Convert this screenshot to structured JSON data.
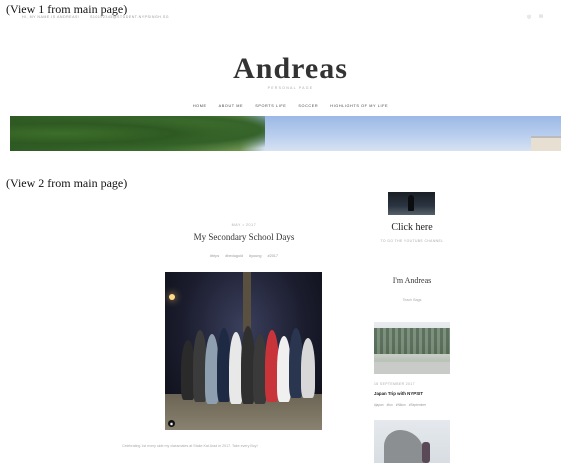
{
  "labels": {
    "view1": "(View 1 from main page)",
    "view2": "(View 2 from main page)"
  },
  "topbar": {
    "name": "HI, MY NAME IS ANDREAS!",
    "email": "S10192345@STUDENT.NYPSINGH.SG",
    "icons": [
      "instagram-icon",
      "mail-icon"
    ]
  },
  "site": {
    "title": "Andreas",
    "subtitle": "PERSONAL PAGE"
  },
  "nav": {
    "items": [
      "HOME",
      "ABOUT ME",
      "SPORTS LIFE",
      "SOCCER",
      "HIGHLIGHTS OF MY LIFE"
    ]
  },
  "post": {
    "date": "MAY • 2017",
    "title": "My Secondary School Days",
    "tags": [
      "#trips",
      "#bedugoid",
      "#young",
      "#2017"
    ],
    "caption": "Celebrating 1st every side my classmates at Stake Kat Arad in 2017. Take every Boy!"
  },
  "sidebar": {
    "click_here": "Click here",
    "click_sub": "TO GO THE YOUTUBE CHANNEL",
    "about_title": "I'm Andreas",
    "about_sub": "Teach Bags",
    "post_date": "18 SEPTEMBER 2017",
    "post_title": "Japan Trip with NYPSIT",
    "post_tags": [
      "#japan",
      "#fun",
      "#Nikon",
      "#September"
    ]
  },
  "colors": {
    "background": "#ffffff",
    "title": "#333333",
    "muted": "#aaaaaa"
  }
}
